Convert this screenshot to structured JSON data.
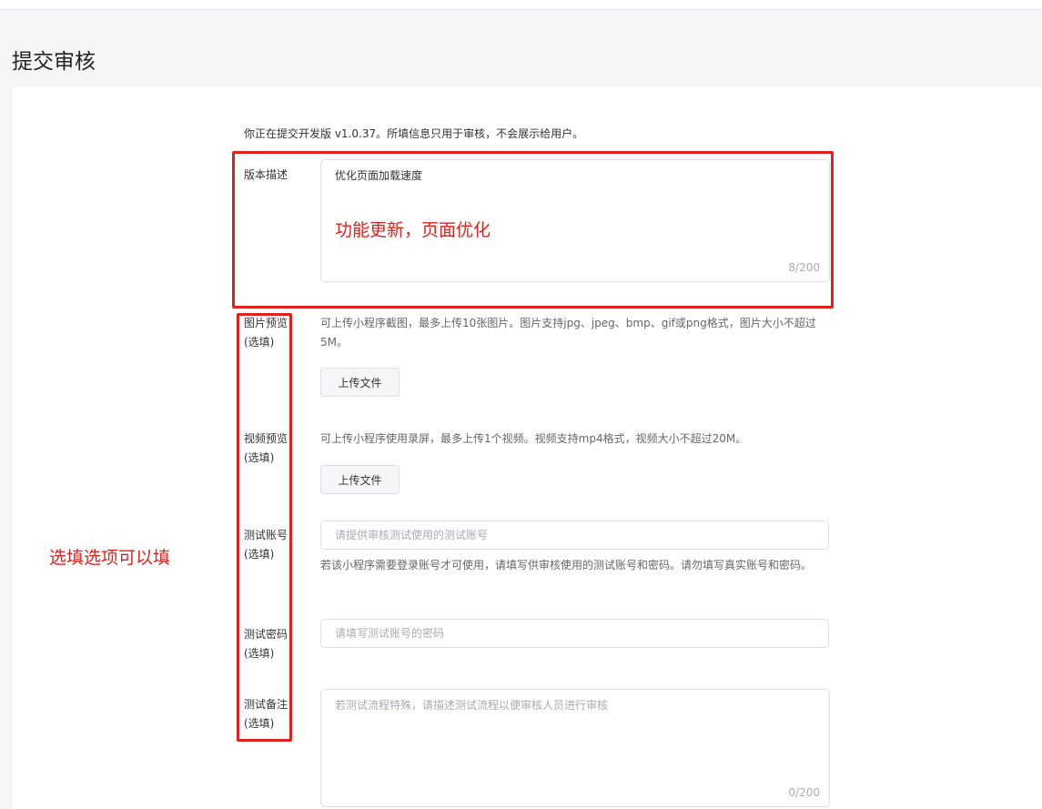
{
  "page": {
    "title": "提交审核"
  },
  "form": {
    "intro": "你正在提交开发版 v1.0.37。所填信息只用于审核，不会展示给用户。",
    "version_desc": {
      "label": "版本描述",
      "value": "优化页面加载速度",
      "counter": "8/200"
    },
    "image_preview": {
      "label_line1": "图片预览",
      "label_line2": "(选填)",
      "hint": "可上传小程序截图，最多上传10张图片。图片支持jpg、jpeg、bmp、gif或png格式，图片大小不超过5M。",
      "button": "上传文件"
    },
    "video_preview": {
      "label_line1": "视频预览",
      "label_line2": "(选填)",
      "hint": "可上传小程序使用录屏，最多上传1个视频。视频支持mp4格式，视频大小不超过20M。",
      "button": "上传文件"
    },
    "test_account": {
      "label_line1": "测试账号",
      "label_line2": "(选填)",
      "placeholder": "请提供审核测试使用的测试账号",
      "hint": "若该小程序需要登录账号才可使用，请填写供审核使用的测试账号和密码。请勿填写真实账号和密码。"
    },
    "test_password": {
      "label_line1": "测试密码",
      "label_line2": "(选填)",
      "placeholder": "请填写测试账号的密码"
    },
    "test_notes": {
      "label_line1": "测试备注",
      "label_line2": "(选填)",
      "placeholder": "若测试流程特殊，请描述测试流程以便审核人员进行审核",
      "counter": "0/200"
    }
  },
  "annotations": {
    "version_note": "功能更新，页面优化",
    "optional_note": "选填选项可以填",
    "color": "#e3201b"
  }
}
